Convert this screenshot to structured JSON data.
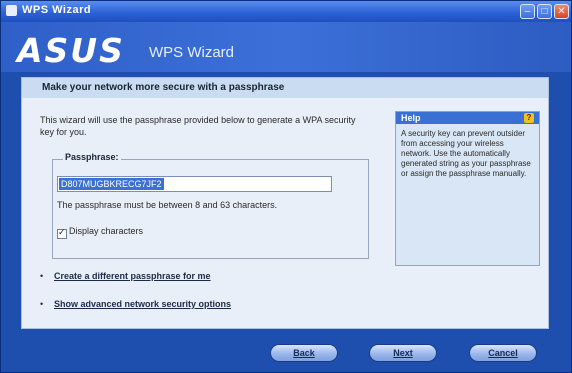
{
  "window": {
    "title": "WPS Wizard",
    "controls": [
      "minimize",
      "maximize",
      "close"
    ]
  },
  "header": {
    "logo_text": "ASUS",
    "wizard_title": "WPS Wizard"
  },
  "content": {
    "heading": "Make your network more secure with a passphrase",
    "description": "This wizard will use the passphrase provided below to generate a WPA security key for you.",
    "passphrase": {
      "label": "Passphrase:",
      "value": "D807MUGBKRECG7JF2",
      "hint": "The passphrase must be between 8 and 63 characters.",
      "display_characters_label": "Display characters",
      "display_characters_checked": true
    },
    "help": {
      "title": "Help",
      "text": "A security key can prevent outsider from accessing your wireless network. Use the automatically generated string as your passphrase or assign the passphrase manually."
    },
    "links": [
      "Create a different passphrase for me",
      "Show advanced network security options"
    ]
  },
  "footer": {
    "back_label": "Back",
    "next_label": "Next",
    "cancel_label": "Cancel"
  },
  "colors": {
    "frame": "#1f4fae",
    "content_bg": "#e8eff8",
    "accent": "#3b70d8"
  }
}
